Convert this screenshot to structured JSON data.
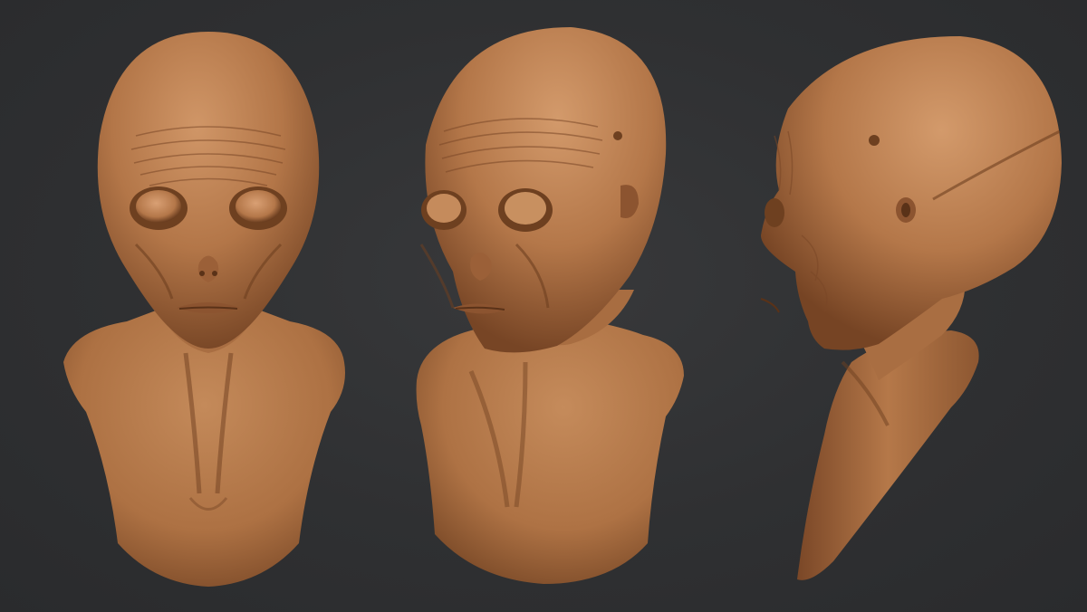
{
  "scene": {
    "background_color": "#2e2f31",
    "clay_color": "#b67a4a",
    "clay_highlight": "#d4996a",
    "clay_shadow": "#6e4222",
    "views": [
      {
        "view": "front",
        "subject": "alien-bust"
      },
      {
        "view": "three-quarter",
        "subject": "alien-bust"
      },
      {
        "view": "side-profile",
        "subject": "alien-bust"
      }
    ]
  }
}
